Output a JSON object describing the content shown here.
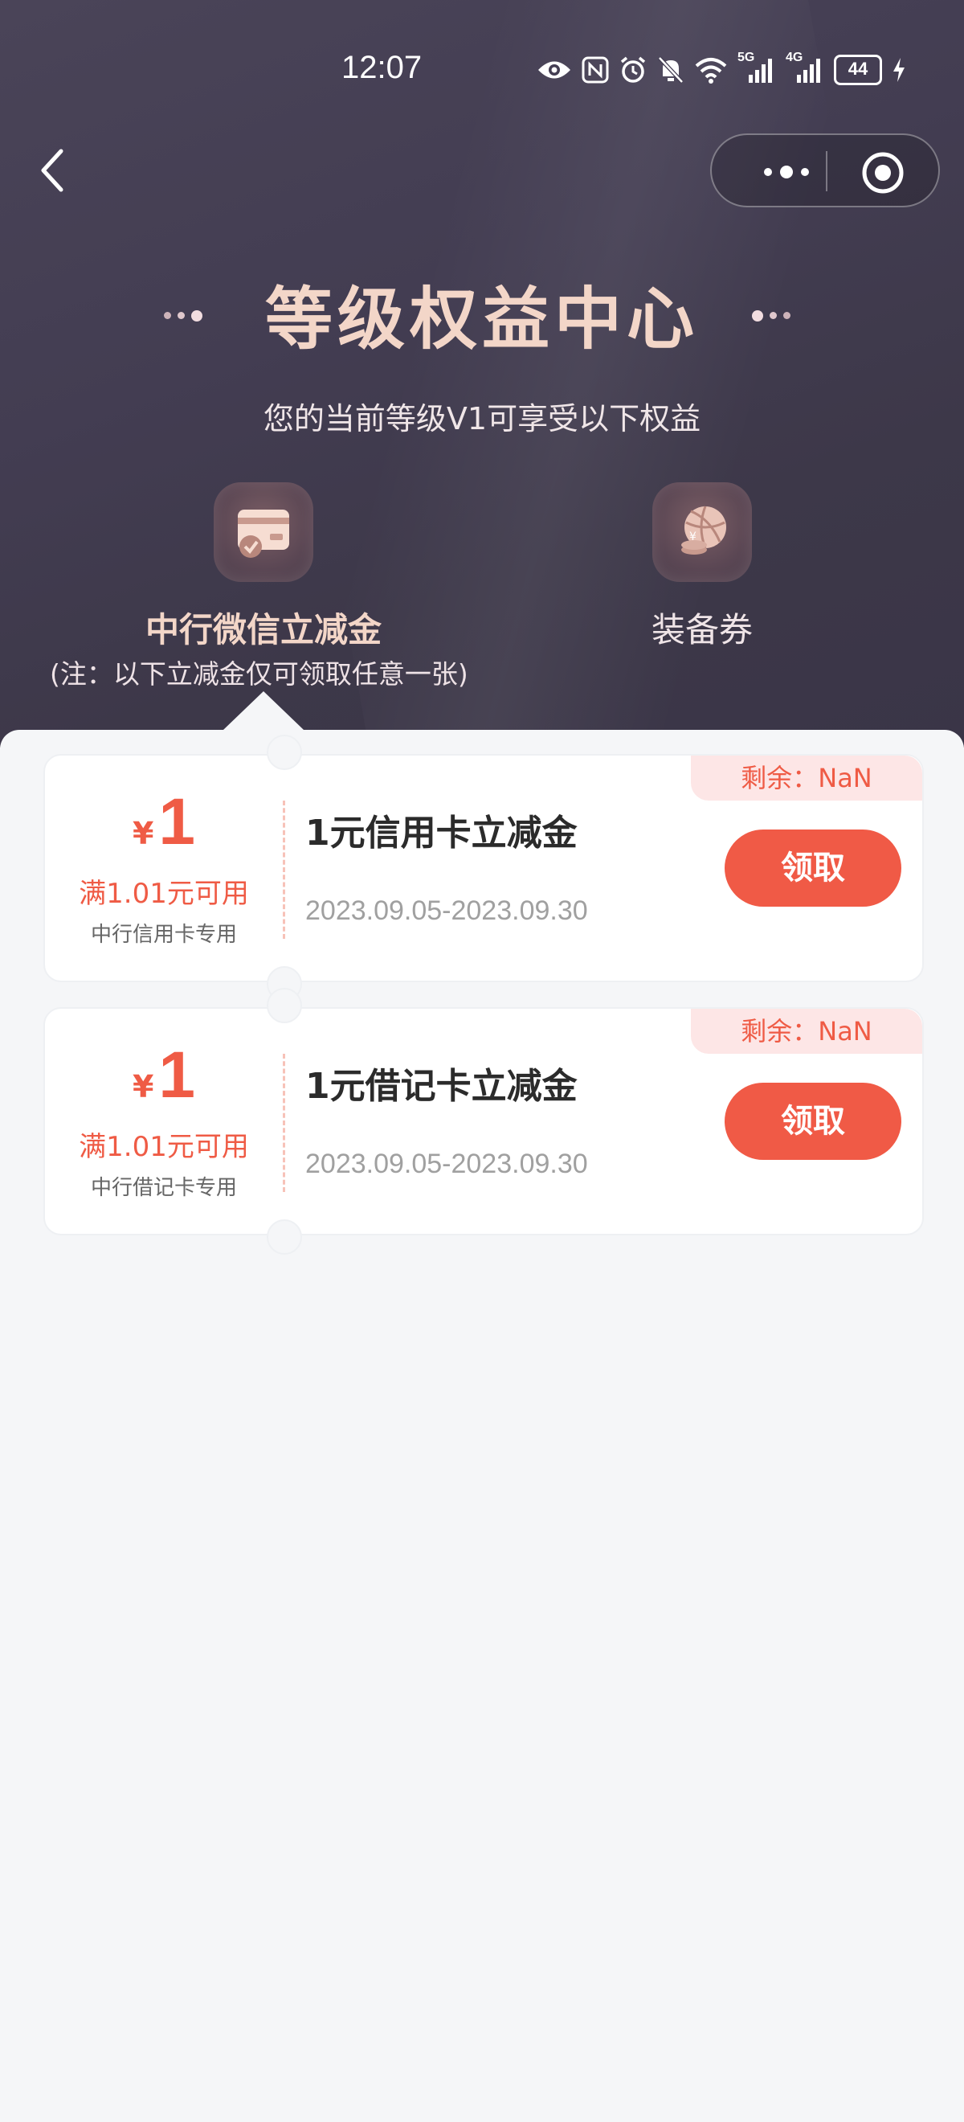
{
  "status_bar": {
    "time": "12:07",
    "net_5g": "5G",
    "net_4g": "4G",
    "battery": "44"
  },
  "header": {
    "title": "等级权益中心",
    "subtitle": "您的当前等级V1可享受以下权益",
    "tabs": [
      {
        "label": "中行微信立减金",
        "icon": "card-coupon-icon",
        "active": true
      },
      {
        "label": "装备券",
        "icon": "basketball-coin-icon",
        "active": false
      }
    ],
    "note": "(注：以下立减金仅可领取任意一张)"
  },
  "colors": {
    "header_bg": "#433d52",
    "title": "#f3d6c8",
    "accent": "#f05a46",
    "page_bg": "#f5f6f8"
  },
  "coupons": [
    {
      "currency": "¥",
      "amount": "1",
      "threshold": "满1.01元可用",
      "scope": "中行信用卡专用",
      "title": "1元信用卡立减金",
      "date_range": "2023.09.05-2023.09.30",
      "remaining": "剩余：NaN",
      "button": "领取"
    },
    {
      "currency": "¥",
      "amount": "1",
      "threshold": "满1.01元可用",
      "scope": "中行借记卡专用",
      "title": "1元借记卡立减金",
      "date_range": "2023.09.05-2023.09.30",
      "remaining": "剩余：NaN",
      "button": "领取"
    }
  ]
}
